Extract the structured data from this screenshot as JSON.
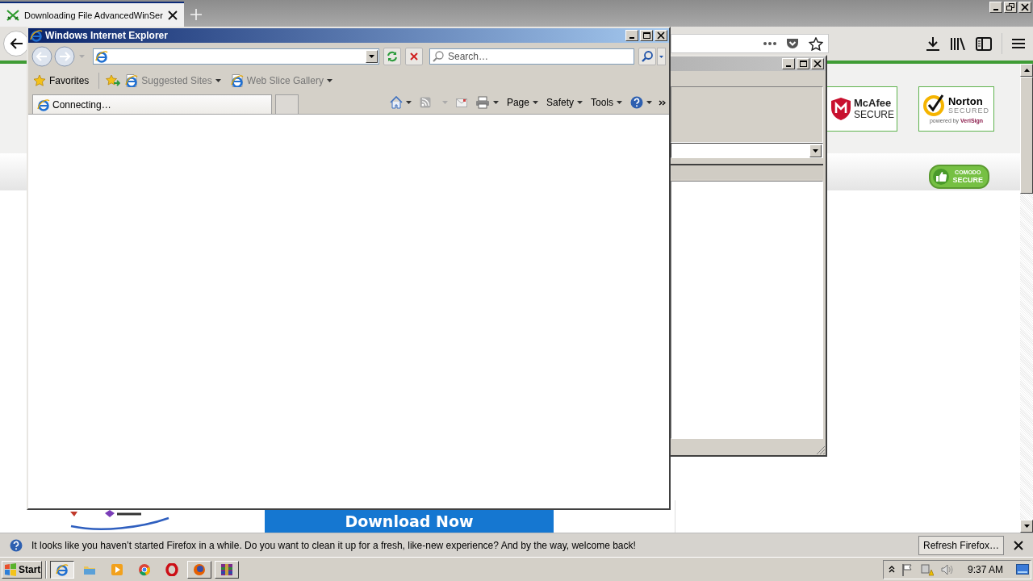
{
  "firefox": {
    "tab": {
      "title": "Downloading File AdvancedWinSer",
      "selected": true
    },
    "page": {
      "badges": [
        {
          "kind": "mcafee",
          "name": "McAfee",
          "word": "SECURE"
        },
        {
          "kind": "norton",
          "name": "Norton",
          "word": "SECURED",
          "tagline": "powered by **VeriSign**"
        }
      ],
      "comodo": {
        "name": "COMODO",
        "word": "SECURE"
      },
      "download_button": "Download Now"
    },
    "notification": {
      "message": "It looks like you haven’t started Firefox in a while. Do you want to clean it up for a fresh, like-new experience? And by the way, welcome back!",
      "button": "Refresh Firefox…"
    }
  },
  "ie": {
    "title": "Windows Internet Explorer",
    "search_placeholder": "Search…",
    "favorites": "Favorites",
    "links": [
      "Suggested Sites",
      "Web Slice Gallery"
    ],
    "tab": {
      "title": "Connecting…",
      "selected": true
    },
    "commands": [
      "Page",
      "Safety",
      "Tools"
    ]
  },
  "taskbar": {
    "start": "Start",
    "apps": [
      {
        "kind": "ie",
        "selected": true,
        "open": true
      },
      {
        "kind": "explorer",
        "selected": false,
        "open": false
      },
      {
        "kind": "media",
        "selected": false,
        "open": false
      },
      {
        "kind": "chrome",
        "selected": false,
        "open": false
      },
      {
        "kind": "opera",
        "selected": false,
        "open": false
      },
      {
        "kind": "firefox",
        "selected": false,
        "open": true
      },
      {
        "kind": "winrar",
        "selected": false,
        "open": true
      }
    ],
    "clock": "9:37 AM"
  }
}
